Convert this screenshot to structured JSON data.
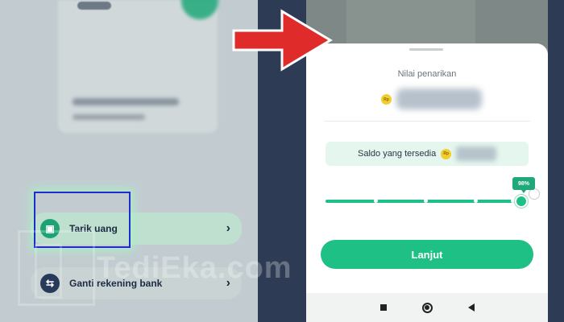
{
  "left_screen": {
    "menu": [
      {
        "label": "Tarik uang",
        "icon": "wallet-download-icon",
        "chevron": "›"
      },
      {
        "label": "Ganti rekening bank",
        "icon": "swap-arrows-icon",
        "chevron": "›"
      }
    ],
    "icon_glyphs": {
      "withdraw": "▣",
      "swap": "⇆"
    }
  },
  "withdraw_sheet": {
    "title": "Nilai penarikan",
    "currency_badge": "Rp",
    "balance_label": "Saldo yang tersedia",
    "slider_value_label": "98%",
    "slider_value": 0.98,
    "continue_label": "Lanjut"
  },
  "watermark": "TediEka.com",
  "colors": {
    "accent_green": "#1fc085",
    "highlight_border": "#1d2ccd",
    "arrow_red": "#e02b2b"
  }
}
